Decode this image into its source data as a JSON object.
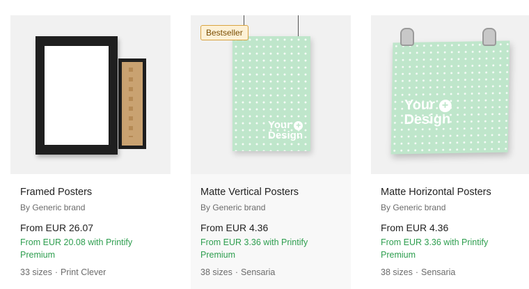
{
  "products": [
    {
      "title": "Framed Posters",
      "brand": "By Generic brand",
      "price": "From EUR 26.07",
      "premium": "From EUR 20.08 with Printify Premium",
      "sizes": "33 sizes",
      "provider": "Print Clever",
      "badge": ""
    },
    {
      "title": "Matte Vertical Posters",
      "brand": "By Generic brand",
      "price": "From EUR 4.36",
      "premium": "From EUR 3.36 with Printify Premium",
      "sizes": "38 sizes",
      "provider": "Sensaria",
      "badge": "Bestseller",
      "image_text_line1": "Your",
      "image_text_line2": "Design"
    },
    {
      "title": "Matte Horizontal Posters",
      "brand": "By Generic brand",
      "price": "From EUR 4.36",
      "premium": "From EUR 3.36 with Printify Premium",
      "sizes": "38 sizes",
      "provider": "Sensaria",
      "badge": "",
      "image_text_line1": "Your",
      "image_text_line2": "Design"
    }
  ],
  "separator": "·",
  "plus_symbol": "+",
  "colors": {
    "premium_green": "#2e9e4f",
    "poster_mint": "#bfe6cb",
    "badge_bg": "#fdf1d6",
    "badge_border": "#d9a441"
  }
}
